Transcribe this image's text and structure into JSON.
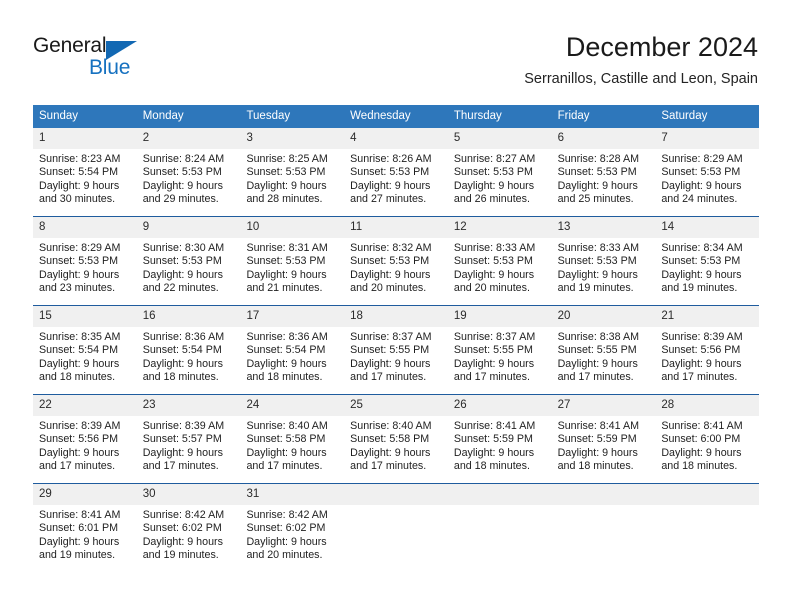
{
  "brand": {
    "name_top": "General",
    "name_bottom": "Blue",
    "accent_color": "#1268b3"
  },
  "header": {
    "title": "December 2024",
    "subtitle": "Serranillos, Castille and Leon, Spain"
  },
  "theme": {
    "header_row_bg": "#2e77bb",
    "row_divider": "#1f5c9e",
    "day_number_bg": "#f0f0f0",
    "text": "#1f1f1f"
  },
  "weekdays": [
    "Sunday",
    "Monday",
    "Tuesday",
    "Wednesday",
    "Thursday",
    "Friday",
    "Saturday"
  ],
  "weeks": [
    [
      {
        "day": "1",
        "sunrise": "Sunrise: 8:23 AM",
        "sunset": "Sunset: 5:54 PM",
        "daylight": "Daylight: 9 hours and 30 minutes."
      },
      {
        "day": "2",
        "sunrise": "Sunrise: 8:24 AM",
        "sunset": "Sunset: 5:53 PM",
        "daylight": "Daylight: 9 hours and 29 minutes."
      },
      {
        "day": "3",
        "sunrise": "Sunrise: 8:25 AM",
        "sunset": "Sunset: 5:53 PM",
        "daylight": "Daylight: 9 hours and 28 minutes."
      },
      {
        "day": "4",
        "sunrise": "Sunrise: 8:26 AM",
        "sunset": "Sunset: 5:53 PM",
        "daylight": "Daylight: 9 hours and 27 minutes."
      },
      {
        "day": "5",
        "sunrise": "Sunrise: 8:27 AM",
        "sunset": "Sunset: 5:53 PM",
        "daylight": "Daylight: 9 hours and 26 minutes."
      },
      {
        "day": "6",
        "sunrise": "Sunrise: 8:28 AM",
        "sunset": "Sunset: 5:53 PM",
        "daylight": "Daylight: 9 hours and 25 minutes."
      },
      {
        "day": "7",
        "sunrise": "Sunrise: 8:29 AM",
        "sunset": "Sunset: 5:53 PM",
        "daylight": "Daylight: 9 hours and 24 minutes."
      }
    ],
    [
      {
        "day": "8",
        "sunrise": "Sunrise: 8:29 AM",
        "sunset": "Sunset: 5:53 PM",
        "daylight": "Daylight: 9 hours and 23 minutes."
      },
      {
        "day": "9",
        "sunrise": "Sunrise: 8:30 AM",
        "sunset": "Sunset: 5:53 PM",
        "daylight": "Daylight: 9 hours and 22 minutes."
      },
      {
        "day": "10",
        "sunrise": "Sunrise: 8:31 AM",
        "sunset": "Sunset: 5:53 PM",
        "daylight": "Daylight: 9 hours and 21 minutes."
      },
      {
        "day": "11",
        "sunrise": "Sunrise: 8:32 AM",
        "sunset": "Sunset: 5:53 PM",
        "daylight": "Daylight: 9 hours and 20 minutes."
      },
      {
        "day": "12",
        "sunrise": "Sunrise: 8:33 AM",
        "sunset": "Sunset: 5:53 PM",
        "daylight": "Daylight: 9 hours and 20 minutes."
      },
      {
        "day": "13",
        "sunrise": "Sunrise: 8:33 AM",
        "sunset": "Sunset: 5:53 PM",
        "daylight": "Daylight: 9 hours and 19 minutes."
      },
      {
        "day": "14",
        "sunrise": "Sunrise: 8:34 AM",
        "sunset": "Sunset: 5:53 PM",
        "daylight": "Daylight: 9 hours and 19 minutes."
      }
    ],
    [
      {
        "day": "15",
        "sunrise": "Sunrise: 8:35 AM",
        "sunset": "Sunset: 5:54 PM",
        "daylight": "Daylight: 9 hours and 18 minutes."
      },
      {
        "day": "16",
        "sunrise": "Sunrise: 8:36 AM",
        "sunset": "Sunset: 5:54 PM",
        "daylight": "Daylight: 9 hours and 18 minutes."
      },
      {
        "day": "17",
        "sunrise": "Sunrise: 8:36 AM",
        "sunset": "Sunset: 5:54 PM",
        "daylight": "Daylight: 9 hours and 18 minutes."
      },
      {
        "day": "18",
        "sunrise": "Sunrise: 8:37 AM",
        "sunset": "Sunset: 5:55 PM",
        "daylight": "Daylight: 9 hours and 17 minutes."
      },
      {
        "day": "19",
        "sunrise": "Sunrise: 8:37 AM",
        "sunset": "Sunset: 5:55 PM",
        "daylight": "Daylight: 9 hours and 17 minutes."
      },
      {
        "day": "20",
        "sunrise": "Sunrise: 8:38 AM",
        "sunset": "Sunset: 5:55 PM",
        "daylight": "Daylight: 9 hours and 17 minutes."
      },
      {
        "day": "21",
        "sunrise": "Sunrise: 8:39 AM",
        "sunset": "Sunset: 5:56 PM",
        "daylight": "Daylight: 9 hours and 17 minutes."
      }
    ],
    [
      {
        "day": "22",
        "sunrise": "Sunrise: 8:39 AM",
        "sunset": "Sunset: 5:56 PM",
        "daylight": "Daylight: 9 hours and 17 minutes."
      },
      {
        "day": "23",
        "sunrise": "Sunrise: 8:39 AM",
        "sunset": "Sunset: 5:57 PM",
        "daylight": "Daylight: 9 hours and 17 minutes."
      },
      {
        "day": "24",
        "sunrise": "Sunrise: 8:40 AM",
        "sunset": "Sunset: 5:58 PM",
        "daylight": "Daylight: 9 hours and 17 minutes."
      },
      {
        "day": "25",
        "sunrise": "Sunrise: 8:40 AM",
        "sunset": "Sunset: 5:58 PM",
        "daylight": "Daylight: 9 hours and 17 minutes."
      },
      {
        "day": "26",
        "sunrise": "Sunrise: 8:41 AM",
        "sunset": "Sunset: 5:59 PM",
        "daylight": "Daylight: 9 hours and 18 minutes."
      },
      {
        "day": "27",
        "sunrise": "Sunrise: 8:41 AM",
        "sunset": "Sunset: 5:59 PM",
        "daylight": "Daylight: 9 hours and 18 minutes."
      },
      {
        "day": "28",
        "sunrise": "Sunrise: 8:41 AM",
        "sunset": "Sunset: 6:00 PM",
        "daylight": "Daylight: 9 hours and 18 minutes."
      }
    ],
    [
      {
        "day": "29",
        "sunrise": "Sunrise: 8:41 AM",
        "sunset": "Sunset: 6:01 PM",
        "daylight": "Daylight: 9 hours and 19 minutes."
      },
      {
        "day": "30",
        "sunrise": "Sunrise: 8:42 AM",
        "sunset": "Sunset: 6:02 PM",
        "daylight": "Daylight: 9 hours and 19 minutes."
      },
      {
        "day": "31",
        "sunrise": "Sunrise: 8:42 AM",
        "sunset": "Sunset: 6:02 PM",
        "daylight": "Daylight: 9 hours and 20 minutes."
      },
      {
        "day": "",
        "sunrise": "",
        "sunset": "",
        "daylight": ""
      },
      {
        "day": "",
        "sunrise": "",
        "sunset": "",
        "daylight": ""
      },
      {
        "day": "",
        "sunrise": "",
        "sunset": "",
        "daylight": ""
      },
      {
        "day": "",
        "sunrise": "",
        "sunset": "",
        "daylight": ""
      }
    ]
  ]
}
